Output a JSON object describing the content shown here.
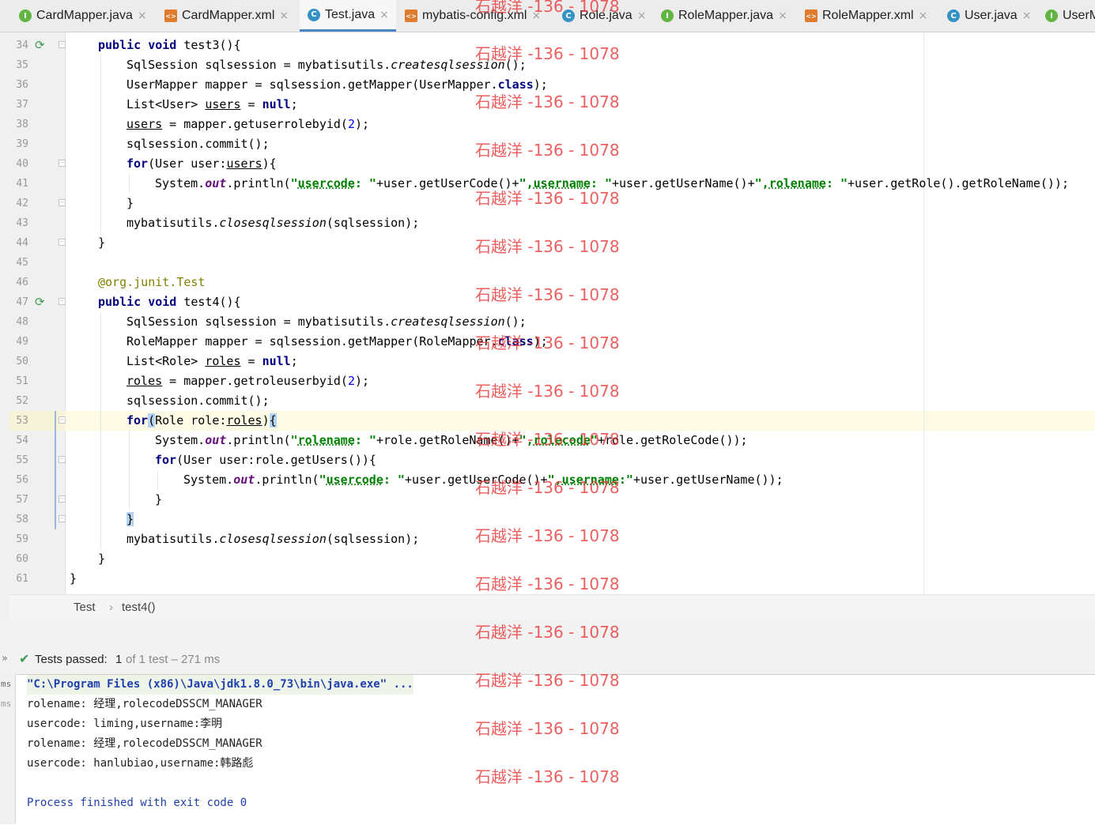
{
  "tabs": [
    {
      "icon": "I",
      "icon_type": "interface-icon",
      "label": "CardMapper.java",
      "active": false
    },
    {
      "icon": "<>",
      "icon_type": "xml-icon",
      "label": "CardMapper.xml",
      "active": false
    },
    {
      "icon": "C",
      "icon_type": "class-icon",
      "label": "Test.java",
      "active": true
    },
    {
      "icon": "<>",
      "icon_type": "xml-icon",
      "label": "mybatis-config.xml",
      "active": false
    },
    {
      "icon": "C",
      "icon_type": "class-icon",
      "label": "Role.java",
      "active": false
    },
    {
      "icon": "I",
      "icon_type": "interface-icon",
      "label": "RoleMapper.java",
      "active": false
    },
    {
      "icon": "<>",
      "icon_type": "xml-icon",
      "label": "RoleMapper.xml",
      "active": false
    },
    {
      "icon": "C",
      "icon_type": "class-icon",
      "label": "User.java",
      "active": false
    },
    {
      "icon": "I",
      "icon_type": "interface-icon",
      "label": "UserM",
      "active": false
    }
  ],
  "tab_close_glyph": "×",
  "editor": {
    "line_numbers": [
      "34",
      "35",
      "36",
      "37",
      "38",
      "39",
      "40",
      "41",
      "42",
      "43",
      "44",
      "45",
      "46",
      "47",
      "48",
      "49",
      "50",
      "51",
      "52",
      "53",
      "54",
      "55",
      "56",
      "57",
      "58",
      "59",
      "60",
      "61"
    ],
    "code": {
      "l34": {
        "a": "public",
        "b": "void",
        "c": " test3(){"
      },
      "l35": {
        "a": "SqlSession sqlsession = mybatisutils.",
        "b": "createsqlsession",
        "c": "();"
      },
      "l36": {
        "a": "UserMapper mapper = sqlsession.getMapper(UserMapper.",
        "b": "class",
        "c": ");"
      },
      "l37": {
        "a": "List<User> ",
        "b": "users",
        "c": " = ",
        "d": "null",
        "e": ";"
      },
      "l38": {
        "a": "users",
        "b": " = mapper.getuserrolebyid(",
        "c": "2",
        "d": ");"
      },
      "l39": {
        "a": "sqlsession.commit();"
      },
      "l40": {
        "a": "for",
        "b": "(User user:",
        "c": "users",
        "d": "){"
      },
      "l41": {
        "a": "System.",
        "b": "out",
        "c": ".println(",
        "d1": "\"",
        "d2": "usercode",
        "d3": ": \"",
        "e": "+user.getUserCode()+",
        "f1": "\",",
        "f2": "username",
        "f3": ": \"",
        "g": "+user.getUserName()+",
        "h1": "\",",
        "h2": "rolename",
        "h3": ": \"",
        "i": "+user.getRole().getRoleName());"
      },
      "l42": {
        "a": "}"
      },
      "l43": {
        "a": "mybatisutils.",
        "b": "closesqlsession",
        "c": "(sqlsession);"
      },
      "l44": {
        "a": "}"
      },
      "l46": {
        "a": "@org.junit.",
        "b": "Test"
      },
      "l47": {
        "a": "public",
        "b": "void",
        "c": " test4(){"
      },
      "l48": {
        "a": "SqlSession sqlsession = mybatisutils.",
        "b": "createsqlsession",
        "c": "();"
      },
      "l49": {
        "a": "RoleMapper mapper = sqlsession.getMapper(RoleMapper.",
        "b": "class",
        "c": ");"
      },
      "l50": {
        "a": "List<Role> ",
        "b": "roles",
        "c": " = ",
        "d": "null",
        "e": ";"
      },
      "l51": {
        "a": "roles",
        "b": " = mapper.getroleuserbyid(",
        "c": "2",
        "d": ");"
      },
      "l52": {
        "a": "sqlsession.commit();"
      },
      "l53": {
        "a": "for",
        "b": "(",
        "c": "Role role:",
        "d": "roles",
        "e": ")",
        "f": "{"
      },
      "l54": {
        "a": "System.",
        "b": "out",
        "c": ".println(",
        "d1": "\"",
        "d2": "rolename",
        "d3": ": \"",
        "e": "+role.getRoleName()+",
        "f1": "\",",
        "f2": "rolecode",
        "f3": "\"",
        "g": "+role.getRoleCode());"
      },
      "l55": {
        "a": "for",
        "b": "(User user:role.getUsers()){"
      },
      "l56": {
        "a": "System.",
        "b": "out",
        "c": ".println(",
        "d1": "\"",
        "d2": "usercode",
        "d3": ": \"",
        "e": "+user.getUserCode()+",
        "f1": "\",",
        "f2": "username",
        "f3": ":\"",
        "g": "+user.getUserName());"
      },
      "l57": {
        "a": "}"
      },
      "l58": {
        "a": "}"
      },
      "l59": {
        "a": "mybatisutils.",
        "b": "closesqlsession",
        "c": "(sqlsession);"
      },
      "l60": {
        "a": "}"
      },
      "l61": {
        "a": "}"
      }
    }
  },
  "breadcrumb": {
    "class": "Test",
    "separator": "›",
    "method": "test4()"
  },
  "run": {
    "expand_glyph": "»",
    "check_glyph": "✔",
    "status_label": "Tests passed:",
    "passed_count": "1",
    "status_rest": "of 1 test – 271 ms",
    "side_labels": [
      "ms",
      "ms"
    ],
    "console_lines": [
      "\"C:\\Program Files (x86)\\Java\\jdk1.8.0_73\\bin\\java.exe\" ...",
      "rolename: 经理,rolecodeDSSCM_MANAGER",
      "usercode: liming,username:李明",
      "rolename: 经理,rolecodeDSSCM_MANAGER",
      "usercode: hanlubiao,username:韩路彪",
      "",
      "Process finished with exit code 0"
    ]
  },
  "watermark": {
    "text": "石越洋 -136 - 1078",
    "color": "#e83c3c"
  },
  "colors": {
    "keyword": "#000080",
    "string": "#008000",
    "number": "#0000ff",
    "field": "#660e7a",
    "annotation": "#808000",
    "accent": "#4a86c8",
    "test_pass": "#3e9a4f",
    "console_link": "#1f3fae"
  }
}
